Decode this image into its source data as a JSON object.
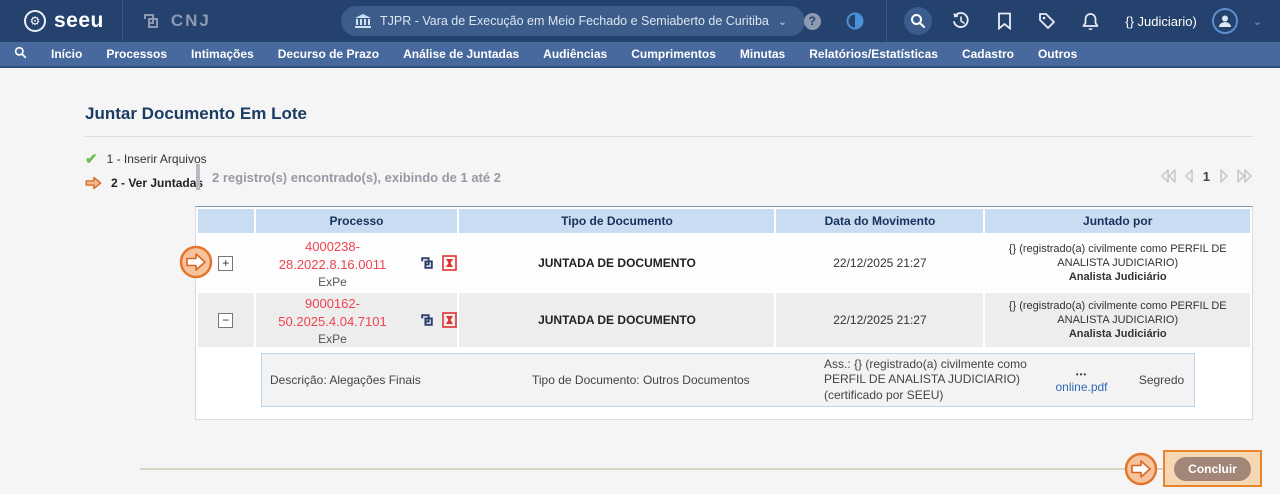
{
  "theme": {
    "topbar_bg": "#25416d",
    "navbar_bg": "#48699d",
    "table_header_bg": "#c9dcf1",
    "process_link_color": "#ee4351",
    "file_link_color": "#2e6db4",
    "hint_orange": "#e8862d",
    "success_green": "#6abf4b",
    "concluir_btn_bg": "#a28779"
  },
  "header": {
    "logo_text": "seeu",
    "logo_gear": "⚙",
    "cnj_text": "CNJ",
    "institution_selector": "TJPR - Vara de Execução em Meio Fechado e Semiaberto de Curitiba",
    "help_glyph": "?",
    "user_label": "{} Judiciario)"
  },
  "nav": {
    "items": [
      "Início",
      "Processos",
      "Intimações",
      "Decurso de Prazo",
      "Análise de Juntadas",
      "Audiências",
      "Cumprimentos",
      "Minutas",
      "Relatórios/Estatísticas",
      "Cadastro",
      "Outros"
    ]
  },
  "page": {
    "title": "Juntar Documento Em Lote",
    "steps": [
      {
        "label": "1 - Inserir Arquivos",
        "status": "done",
        "glyph": "✔"
      },
      {
        "label": "2 - Ver Juntadas",
        "status": "current"
      }
    ],
    "results_summary": "2 registro(s) encontrado(s), exibindo de 1 até 2",
    "pagination": {
      "current_page": "1"
    }
  },
  "table": {
    "headers": [
      "",
      "Processo",
      "Tipo de Documento",
      "Data do Movimento",
      "Juntado por"
    ],
    "rows": [
      {
        "expander": "+",
        "process_number": "4000238-28.2022.8.16.0011",
        "process_class": "ExPe",
        "doc_type": "JUNTADA DE DOCUMENTO",
        "movement_date": "22/12/2025 21:27",
        "joined_by": "{} (registrado(a) civilmente como PERFIL DE ANALISTA JUDICIARIO)",
        "joined_by_role": "Analista Judiciário"
      },
      {
        "expander": "−",
        "process_number": "9000162-50.2025.4.04.7101",
        "process_class": "ExPe",
        "doc_type": "JUNTADA DE DOCUMENTO",
        "movement_date": "22/12/2025 21:27",
        "joined_by": "{} (registrado(a) civilmente como PERFIL DE ANALISTA JUDICIARIO)",
        "joined_by_role": "Analista Judiciário"
      }
    ],
    "expanded_detail": {
      "description": "Descrição: Alegações Finais",
      "doc_type": "Tipo de Documento: Outros Documentos",
      "signature": "Ass.: {} (registrado(a) civilmente como PERFIL DE ANALISTA JUDICIARIO) (certificado por SEEU)",
      "file_menu": "•••",
      "file_link": "online.pdf",
      "secret_label": "Segredo"
    }
  },
  "footer": {
    "conclude_label": "Concluir"
  }
}
